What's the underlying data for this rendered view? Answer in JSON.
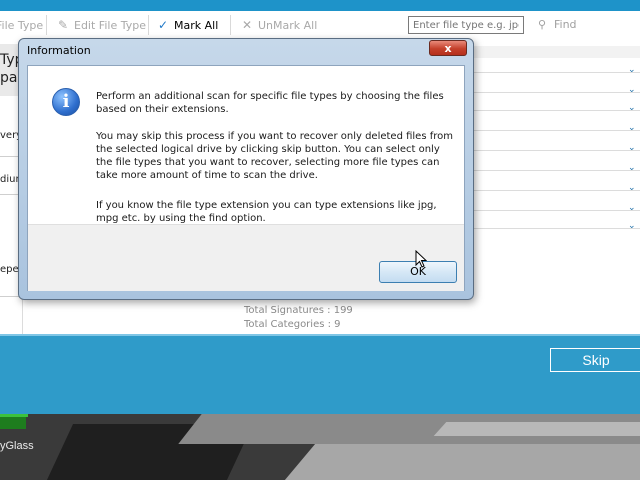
{
  "toolbar": {
    "file_type": "File Type",
    "edit_file_type": "Edit File Type",
    "mark_all": "Mark All",
    "unmark_all": "UnMark All",
    "search_placeholder": "Enter file type e.g. jpg",
    "find": "Find"
  },
  "left_panel": {
    "typ": "Typ",
    "pand": "pand",
    "very": "very",
    "dium": "dium",
    "epen": "epen"
  },
  "totals": {
    "signatures": "Total Signatures : 199",
    "categories": "Total Categories : 9"
  },
  "footer": {
    "skip": "Skip"
  },
  "taskbar": {
    "label": "yGlass"
  },
  "dialog": {
    "title": "Information",
    "close": "x",
    "paragraph1": "Perform an additional scan for specific file types by choosing the files based on their extensions.",
    "paragraph2": "You may skip this process if you want to recover only deleted files from the selected logical drive by clicking skip button. You can select only the file types that you want to recover, selecting more file types can take more amount of time to scan the drive.",
    "paragraph3": "If you know the file type extension you can type extensions like jpg, mpg etc. by using the find option.",
    "ok": "OK"
  },
  "icons": {
    "info": "info-icon",
    "check": "check-icon",
    "chevron": "chevron-down-icon"
  },
  "colors": {
    "accent": "#2f9bc9",
    "close": "#c4402b"
  }
}
